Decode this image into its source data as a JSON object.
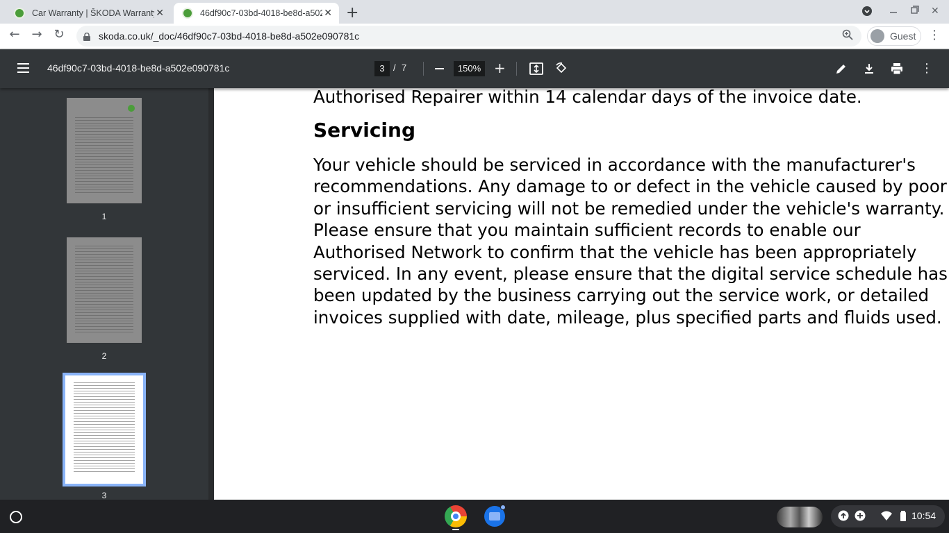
{
  "browser": {
    "tabs": [
      {
        "title": "Car Warranty | ŠKODA Warranty",
        "active": false
      },
      {
        "title": "46df90c7-03bd-4018-be8d-a502e090781c",
        "active": true
      }
    ],
    "url": "skoda.co.uk/_doc/46df90c7-03bd-4018-be8d-a502e090781c",
    "profile_label": "Guest"
  },
  "pdf_viewer": {
    "title": "46df90c7-03bd-4018-be8d-a502e090781c",
    "current_page": "3",
    "page_separator": "/",
    "total_pages": "7",
    "zoom": "150%",
    "thumbnails": [
      {
        "number": "1",
        "active": false
      },
      {
        "number": "2",
        "active": false
      },
      {
        "number": "3",
        "active": true
      }
    ]
  },
  "document": {
    "prev_line": "Authorised Repairer within 14 calendar days of the invoice date.",
    "heading": "Servicing",
    "paragraph_lines": [
      "Your vehicle should be serviced in accordance with the manufacturer's",
      "recommendations. Any damage to or defect in the vehicle caused by poor",
      "or insufficient servicing will not be remedied under the vehicle's warranty.",
      "Please ensure that you maintain sufficient records to enable our",
      "Authorised Network to confirm that the vehicle has been appropriately",
      "serviced. In any event, please ensure that the digital service schedule has",
      "been updated by the business carrying out the service work, or detailed",
      "invoices supplied with date, mileage, plus specified parts and fluids used."
    ]
  },
  "shelf": {
    "time": "10:54"
  },
  "colors": {
    "pdf_toolbar": "#323639",
    "active_thumb_border": "#8ab4f8",
    "skoda_green": "#4b9d3a"
  }
}
